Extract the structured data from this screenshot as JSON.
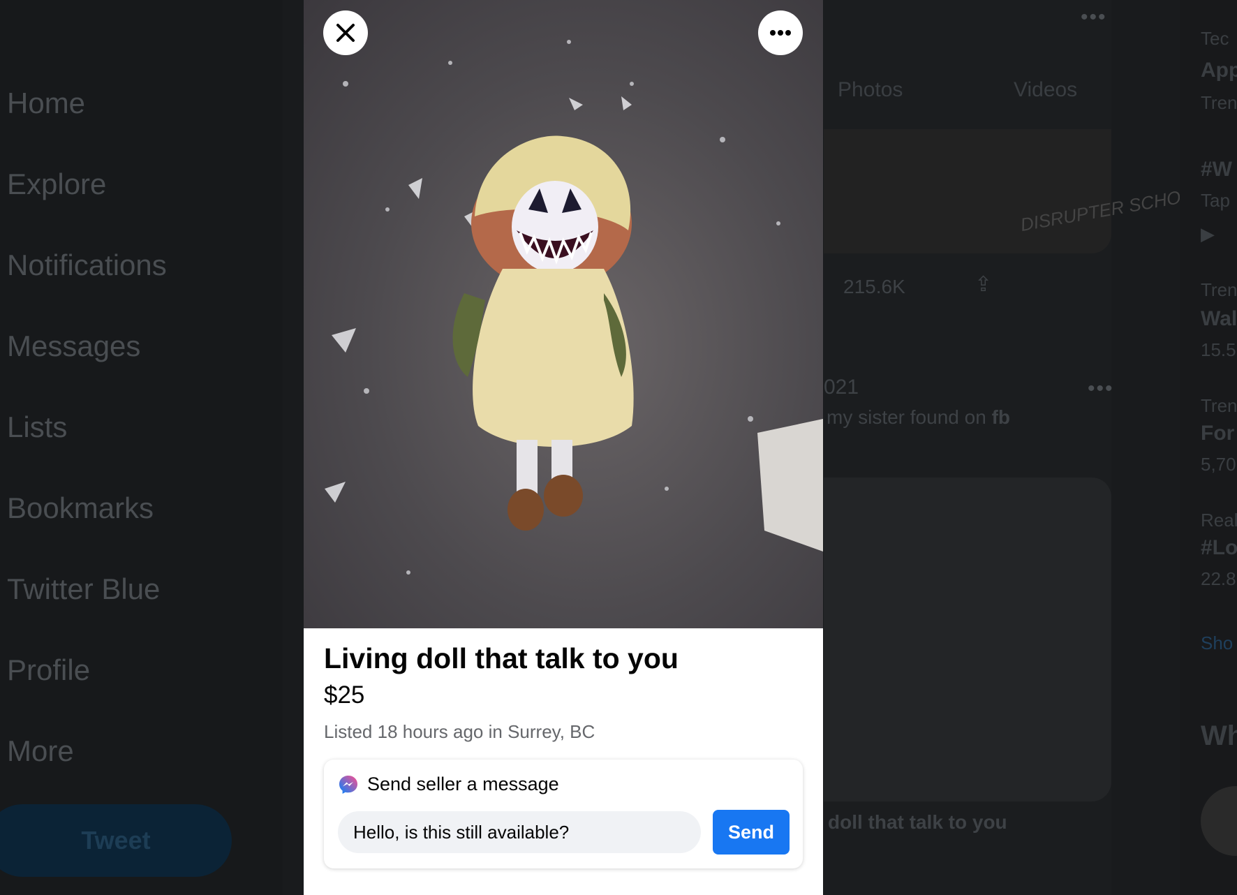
{
  "sidebar": {
    "items": [
      {
        "label": "Home"
      },
      {
        "label": "Explore"
      },
      {
        "label": "Notifications"
      },
      {
        "label": "Messages"
      },
      {
        "label": "Lists"
      },
      {
        "label": "Bookmarks"
      },
      {
        "label": "Twitter Blue"
      },
      {
        "label": "Profile"
      },
      {
        "label": "More"
      }
    ],
    "tweet_label": "Tweet"
  },
  "timeline": {
    "tabs": [
      "Photos",
      "Videos"
    ],
    "banner_text": "DISRUPTER SCHOOL",
    "view_count": "215.6K",
    "date_fragment": "021",
    "tweet_text_fragment": "my sister found on",
    "tweet_text_bold": "fb",
    "image_caption_fragment": "doll that talk to you"
  },
  "trends": {
    "items": [
      {
        "category": "Tec",
        "title": "App",
        "meta": "Tren"
      },
      {
        "category": "",
        "title": "#W",
        "meta": "Tap"
      },
      {
        "category": "Tren",
        "title": "Wal",
        "meta": "15.5"
      },
      {
        "category": "Tren",
        "title": "For",
        "meta": "5,70"
      },
      {
        "category": "Real",
        "title": "#Lo",
        "meta": "22.8"
      }
    ],
    "show_more": "Sho",
    "who_heading": "Wh"
  },
  "listing": {
    "title": "Living doll that talk to you",
    "price": "$25",
    "listed": "Listed 18 hours ago in Surrey, BC",
    "message_header": "Send seller a message",
    "message_value": "Hello, is this still available?",
    "send_label": "Send"
  },
  "colors": {
    "send_button": "#1877f2",
    "messenger_gradient_start": "#0084ff",
    "messenger_gradient_end": "#ff4d8d"
  }
}
